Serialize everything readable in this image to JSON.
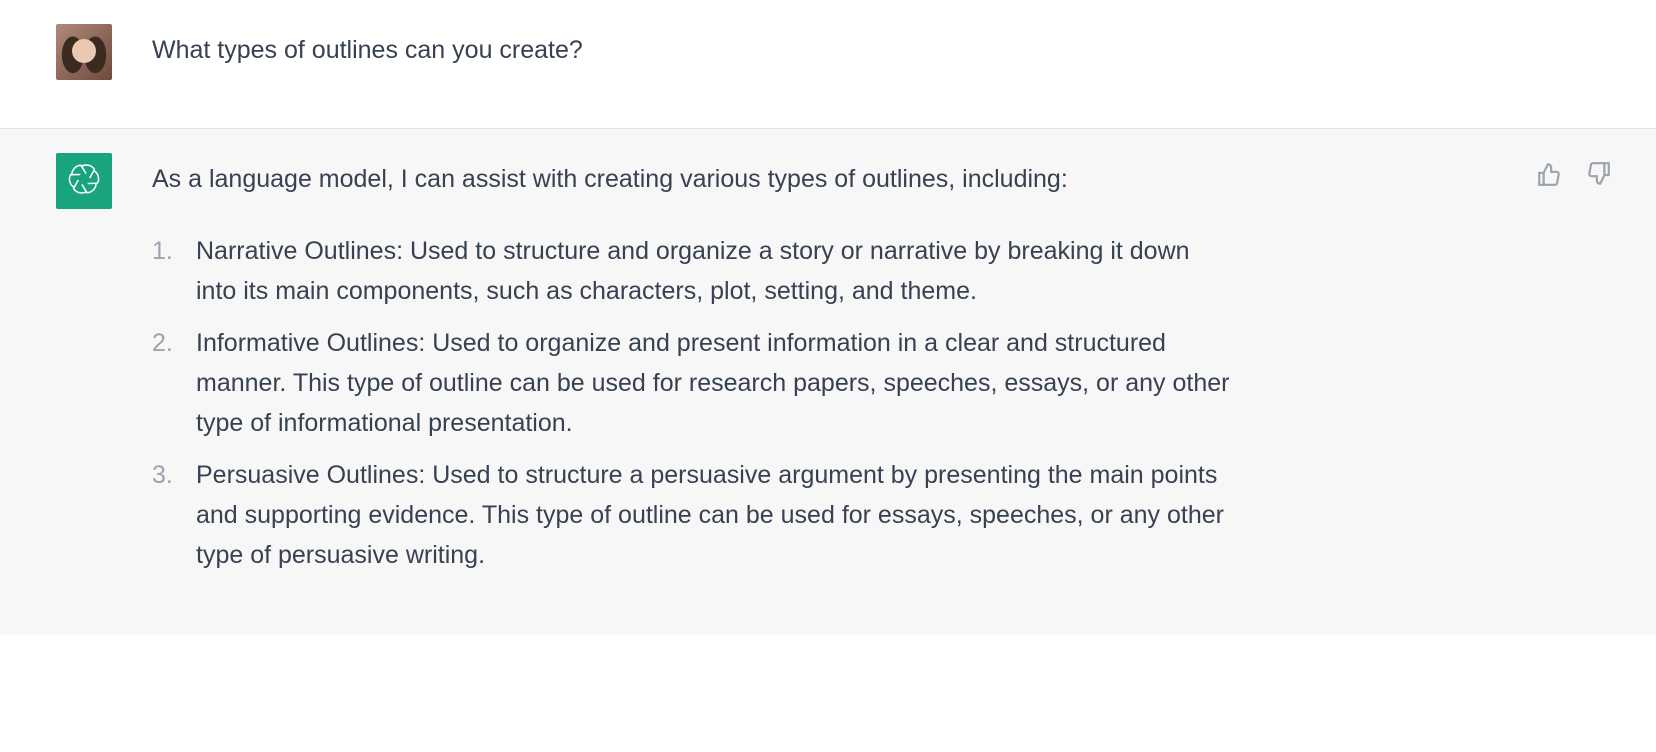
{
  "messages": {
    "user": {
      "text": "What types of outlines can you create?"
    },
    "assistant": {
      "intro": "As a language model, I can assist with creating various types of outlines, including:",
      "items": [
        "Narrative Outlines: Used to structure and organize a story or narrative by breaking it down into its main components, such as characters, plot, setting, and theme.",
        "Informative Outlines: Used to organize and present information in a clear and structured manner. This type of outline can be used for research papers, speeches, essays, or any other type of informational presentation.",
        "Persuasive Outlines: Used to structure a persuasive argument by presenting the main points and supporting evidence. This type of outline can be used for essays, speeches, or any other type of persuasive writing."
      ]
    }
  },
  "icons": {
    "assistant": "chatgpt-logo",
    "thumbs_up": "thumbs-up-icon",
    "thumbs_down": "thumbs-down-icon"
  }
}
